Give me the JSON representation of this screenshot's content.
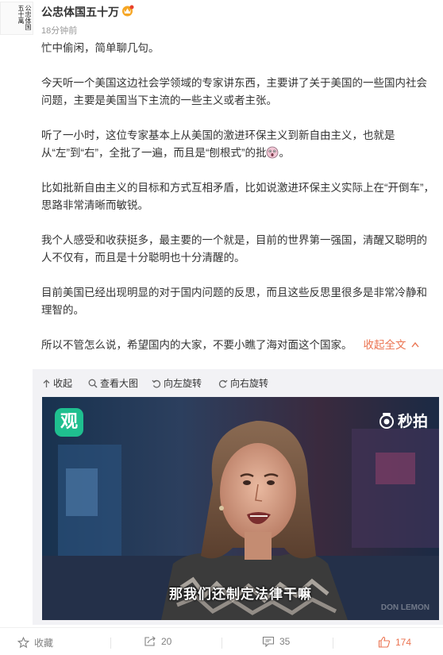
{
  "post": {
    "author": "公忠体国五十万",
    "avatar_text": "公忠体国五十萬",
    "timestamp": "18分钟前",
    "paragraphs": {
      "p1": "忙中偷闲，简单聊几句。",
      "p2": "今天听一个美国这边社会学领域的专家讲东西，主要讲了关于美国的一些国内社会问题，主要是美国当下主流的一些主义或者主张。",
      "p3": "听了一小时，这位专家基本上从美国的激进环保主义到新自由主义，也就是从“左”到“右”，全批了一遍，而且是“刨根式”的批",
      "p4": "比如批新自由主义的目标和方式互相矛盾，比如说激进环保主义实际上在“开倒车”，思路非常清晰而敏锐。",
      "p5": "我个人感受和收获挺多，最主要的一个就是，目前的世界第一强国，清醒又聪明的人不仅有，而且是十分聪明也十分清醒的。",
      "p6": "目前美国已经出现明显的对于国内问题的反思，而且这些反思里很多是非常冷静和理智的。",
      "p7": "所以不管怎么说，希望国内的大家，不要小瞧了海对面这个国家。"
    },
    "collapse_label": "收起全文"
  },
  "media": {
    "toolbar": {
      "collapse": "收起",
      "view_large": "查看大图",
      "rotate_left": "向左旋转",
      "rotate_right": "向右旋转"
    },
    "video": {
      "app_logo": "观",
      "brand": "秒拍",
      "subtitle": "那我们还制定法律干嘛",
      "watermark": "DON LEMON"
    }
  },
  "actions": {
    "favorite": "收藏",
    "repost": "20",
    "comment": "35",
    "like": "174"
  },
  "colors": {
    "accent": "#eb7350",
    "text": "#333333",
    "muted": "#999999",
    "toolbar_bg": "#f2f2f5"
  },
  "icons": [
    "vip-crown-icon",
    "shock-face-icon",
    "chevron-up-icon",
    "collapse-arrow-icon",
    "magnify-icon",
    "rotate-left-icon",
    "rotate-right-icon",
    "miaopai-camera-icon",
    "star-icon",
    "repost-icon",
    "comment-icon",
    "thumbs-up-icon"
  ]
}
